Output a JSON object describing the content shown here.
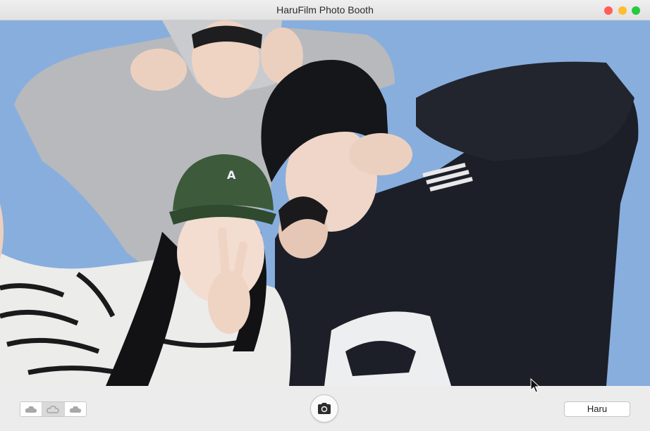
{
  "window": {
    "title": "HaruFilm Photo Booth"
  },
  "toolbar": {
    "segments": [
      {
        "icon": "cloud-icon",
        "selected": false
      },
      {
        "icon": "cloud-icon",
        "selected": true
      },
      {
        "icon": "cloud-icon",
        "selected": false
      }
    ],
    "shutter_icon": "camera-icon",
    "name_button_label": "Haru"
  },
  "colors": {
    "close": "#fe5f57",
    "minimize": "#febc2e",
    "zoom": "#28c840",
    "booth_background": "#8db2e0"
  }
}
